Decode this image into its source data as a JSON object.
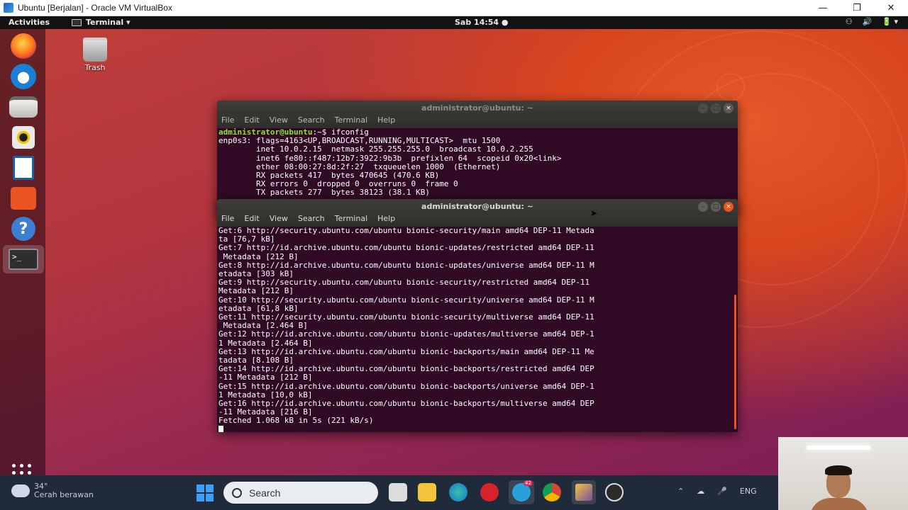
{
  "vbox": {
    "title": "Ubuntu [Berjalan] - Oracle VM VirtualBox",
    "minimize": "—",
    "restore": "❐",
    "close": "✕"
  },
  "topbar": {
    "activities": "Activities",
    "app_name": "Terminal ▾",
    "clock": "Sab 14:54 ●",
    "tray": [
      "⚇",
      "🔊",
      "🔋 ▾"
    ]
  },
  "desktop": {
    "trash_label": "Trash"
  },
  "terminal_back": {
    "title": "administrator@ubuntu: ~",
    "menu": [
      "File",
      "Edit",
      "View",
      "Search",
      "Terminal",
      "Help"
    ],
    "prompt": "administrator@ubuntu",
    "command": ":~$ ifconfig",
    "lines": [
      "enp0s3: flags=4163<UP,BROADCAST,RUNNING,MULTICAST>  mtu 1500",
      "        inet 10.0.2.15  netmask 255.255.255.0  broadcast 10.0.2.255",
      "        inet6 fe80::f487:12b7:3922:9b3b  prefixlen 64  scopeid 0x20<link>",
      "        ether 08:00:27:8d:2f:27  txqueuelen 1000  (Ethernet)",
      "        RX packets 417  bytes 470645 (470.6 KB)",
      "        RX errors 0  dropped 0  overruns 0  frame 0",
      "        TX packets 277  bytes 38123 (38.1 KB)"
    ]
  },
  "terminal_front": {
    "title": "administrator@ubuntu: ~",
    "menu": [
      "File",
      "Edit",
      "View",
      "Search",
      "Terminal",
      "Help"
    ],
    "lines": [
      "Get:6 http://security.ubuntu.com/ubuntu bionic-security/main amd64 DEP-11 Metada",
      "ta [76,7 kB]",
      "Get:7 http://id.archive.ubuntu.com/ubuntu bionic-updates/restricted amd64 DEP-11",
      " Metadata [212 B]",
      "Get:8 http://id.archive.ubuntu.com/ubuntu bionic-updates/universe amd64 DEP-11 M",
      "etadata [303 kB]",
      "Get:9 http://security.ubuntu.com/ubuntu bionic-security/restricted amd64 DEP-11",
      "Metadata [212 B]",
      "Get:10 http://security.ubuntu.com/ubuntu bionic-security/universe amd64 DEP-11 M",
      "etadata [61,8 kB]",
      "Get:11 http://security.ubuntu.com/ubuntu bionic-security/multiverse amd64 DEP-11",
      " Metadata [2.464 B]",
      "Get:12 http://id.archive.ubuntu.com/ubuntu bionic-updates/multiverse amd64 DEP-1",
      "1 Metadata [2.464 B]",
      "Get:13 http://id.archive.ubuntu.com/ubuntu bionic-backports/main amd64 DEP-11 Me",
      "tadata [8.108 B]",
      "Get:14 http://id.archive.ubuntu.com/ubuntu bionic-backports/restricted amd64 DEP",
      "-11 Metadata [212 B]",
      "Get:15 http://id.archive.ubuntu.com/ubuntu bionic-backports/universe amd64 DEP-1",
      "1 Metadata [10,0 kB]",
      "Get:16 http://id.archive.ubuntu.com/ubuntu bionic-backports/multiverse amd64 DEP",
      "-11 Metadata [216 B]",
      "Fetched 1.068 kB in 5s (221 kB/s)"
    ]
  },
  "taskbar": {
    "weather_temp": "34°",
    "weather_desc": "Cerah berawan",
    "search_placeholder": "Search",
    "telegram_badge": "42",
    "tray_lang": "ENG"
  },
  "colors": {
    "ubuntu_orange": "#e95420",
    "terminal_bg": "#300a24",
    "prompt_green": "#8ae234"
  }
}
